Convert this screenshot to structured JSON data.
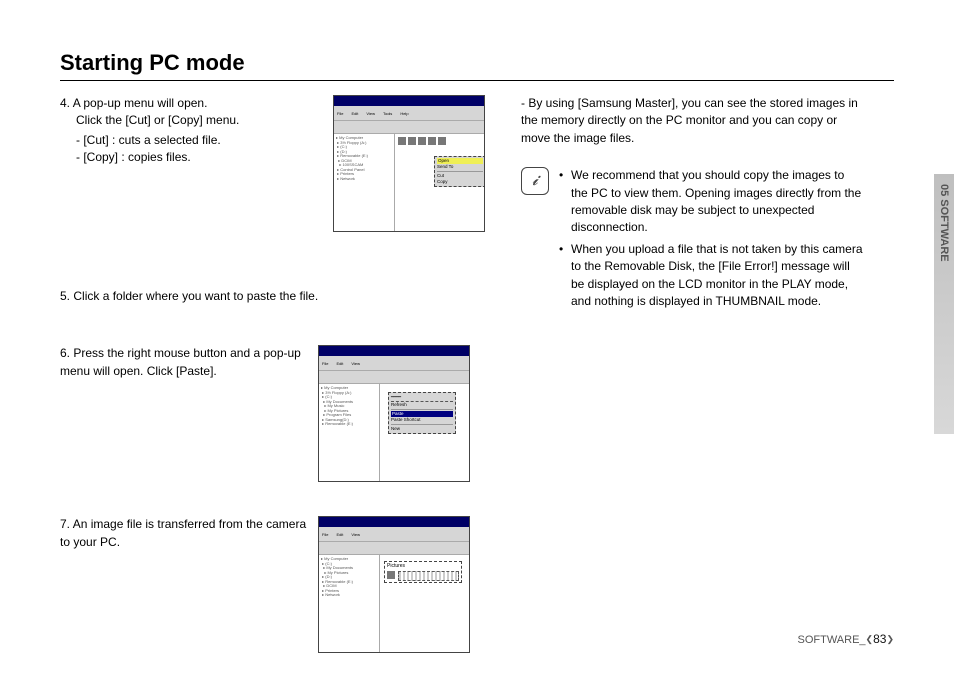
{
  "heading": "Starting PC mode",
  "left": {
    "step4": {
      "num": "4.",
      "line1": "A pop-up menu will open.",
      "line2": "Click the [Cut] or [Copy] menu.",
      "cut": "- [Cut]     : cuts a selected file.",
      "copy": "- [Copy]  : copies files."
    },
    "step5": {
      "num": "5.",
      "text": "Click a folder where you want to paste the file."
    },
    "step6": {
      "num": "6.",
      "text": "Press the right mouse button and a pop-up menu will open. Click [Paste]."
    },
    "step7": {
      "num": "7.",
      "text": "An image file is transferred from the camera to your PC."
    },
    "fig4menu": {
      "open": "Open",
      "send": "Send To",
      "cut": "Cut",
      "copy": "Copy"
    },
    "fig6menu": {
      "refresh": "Refresh",
      "paste": "Paste",
      "pasteShortcut": "Paste Shortcut",
      "new": "New"
    },
    "fig7": {
      "label": "Pictures"
    },
    "toolbar": {
      "file": "File",
      "edit": "Edit",
      "view": "View",
      "tools": "Tools",
      "help": "Help"
    }
  },
  "right": {
    "samsung": "- By using [Samsung Master], you can see the stored images in the memory directly on the PC monitor and you can copy or move the image files.",
    "bullet1": "We recommend that you should copy the images to the PC to view them. Opening images directly from the removable disk may be subject to unexpected disconnection.",
    "bullet2": "When you upload a file that is not taken by this camera to the Removable Disk, the [File Error!] message will be displayed on the LCD monitor in the PLAY mode, and nothing is displayed in THUMBNAIL mode."
  },
  "sideTab": "05 SOFTWARE",
  "footer": {
    "label": "SOFTWARE_",
    "page": "83"
  }
}
